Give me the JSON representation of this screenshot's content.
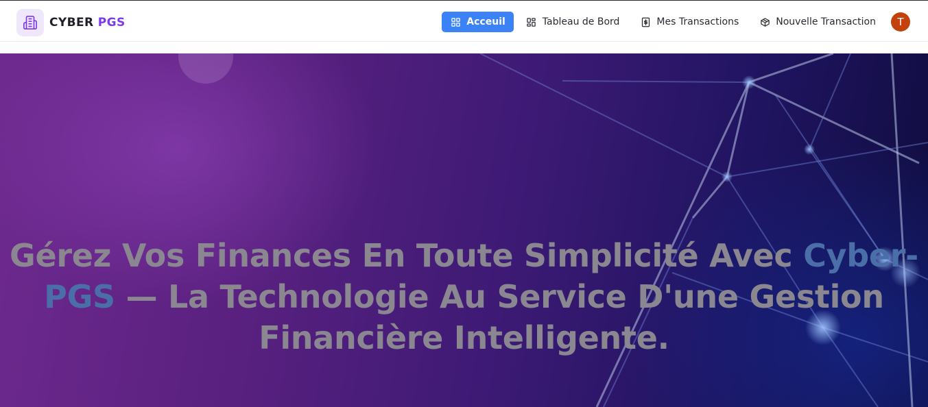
{
  "brand": {
    "logo_icon": "building-icon",
    "name_part1": "CYBER",
    "name_part2": "PGS",
    "accent_color": "#7c3aed"
  },
  "nav": {
    "items": [
      {
        "label": "Acceuil",
        "icon": "grid-icon",
        "active": true
      },
      {
        "label": "Tableau de Bord",
        "icon": "dashboard-icon",
        "active": false
      },
      {
        "label": "Mes Transactions",
        "icon": "dollar-document-icon",
        "active": false
      },
      {
        "label": "Nouvelle Transaction",
        "icon": "package-icon",
        "active": false
      }
    ],
    "active_color": "#3b82f6"
  },
  "user": {
    "avatar_initial": "T",
    "avatar_color": "#c2410c"
  },
  "hero": {
    "title_before": "Gérez Vos Finances En Toute Simplicité Avec ",
    "title_accent": "Cyber-PGS",
    "title_after": " — La Technologie Au Service D'une Gestion Financière Intelligente."
  }
}
